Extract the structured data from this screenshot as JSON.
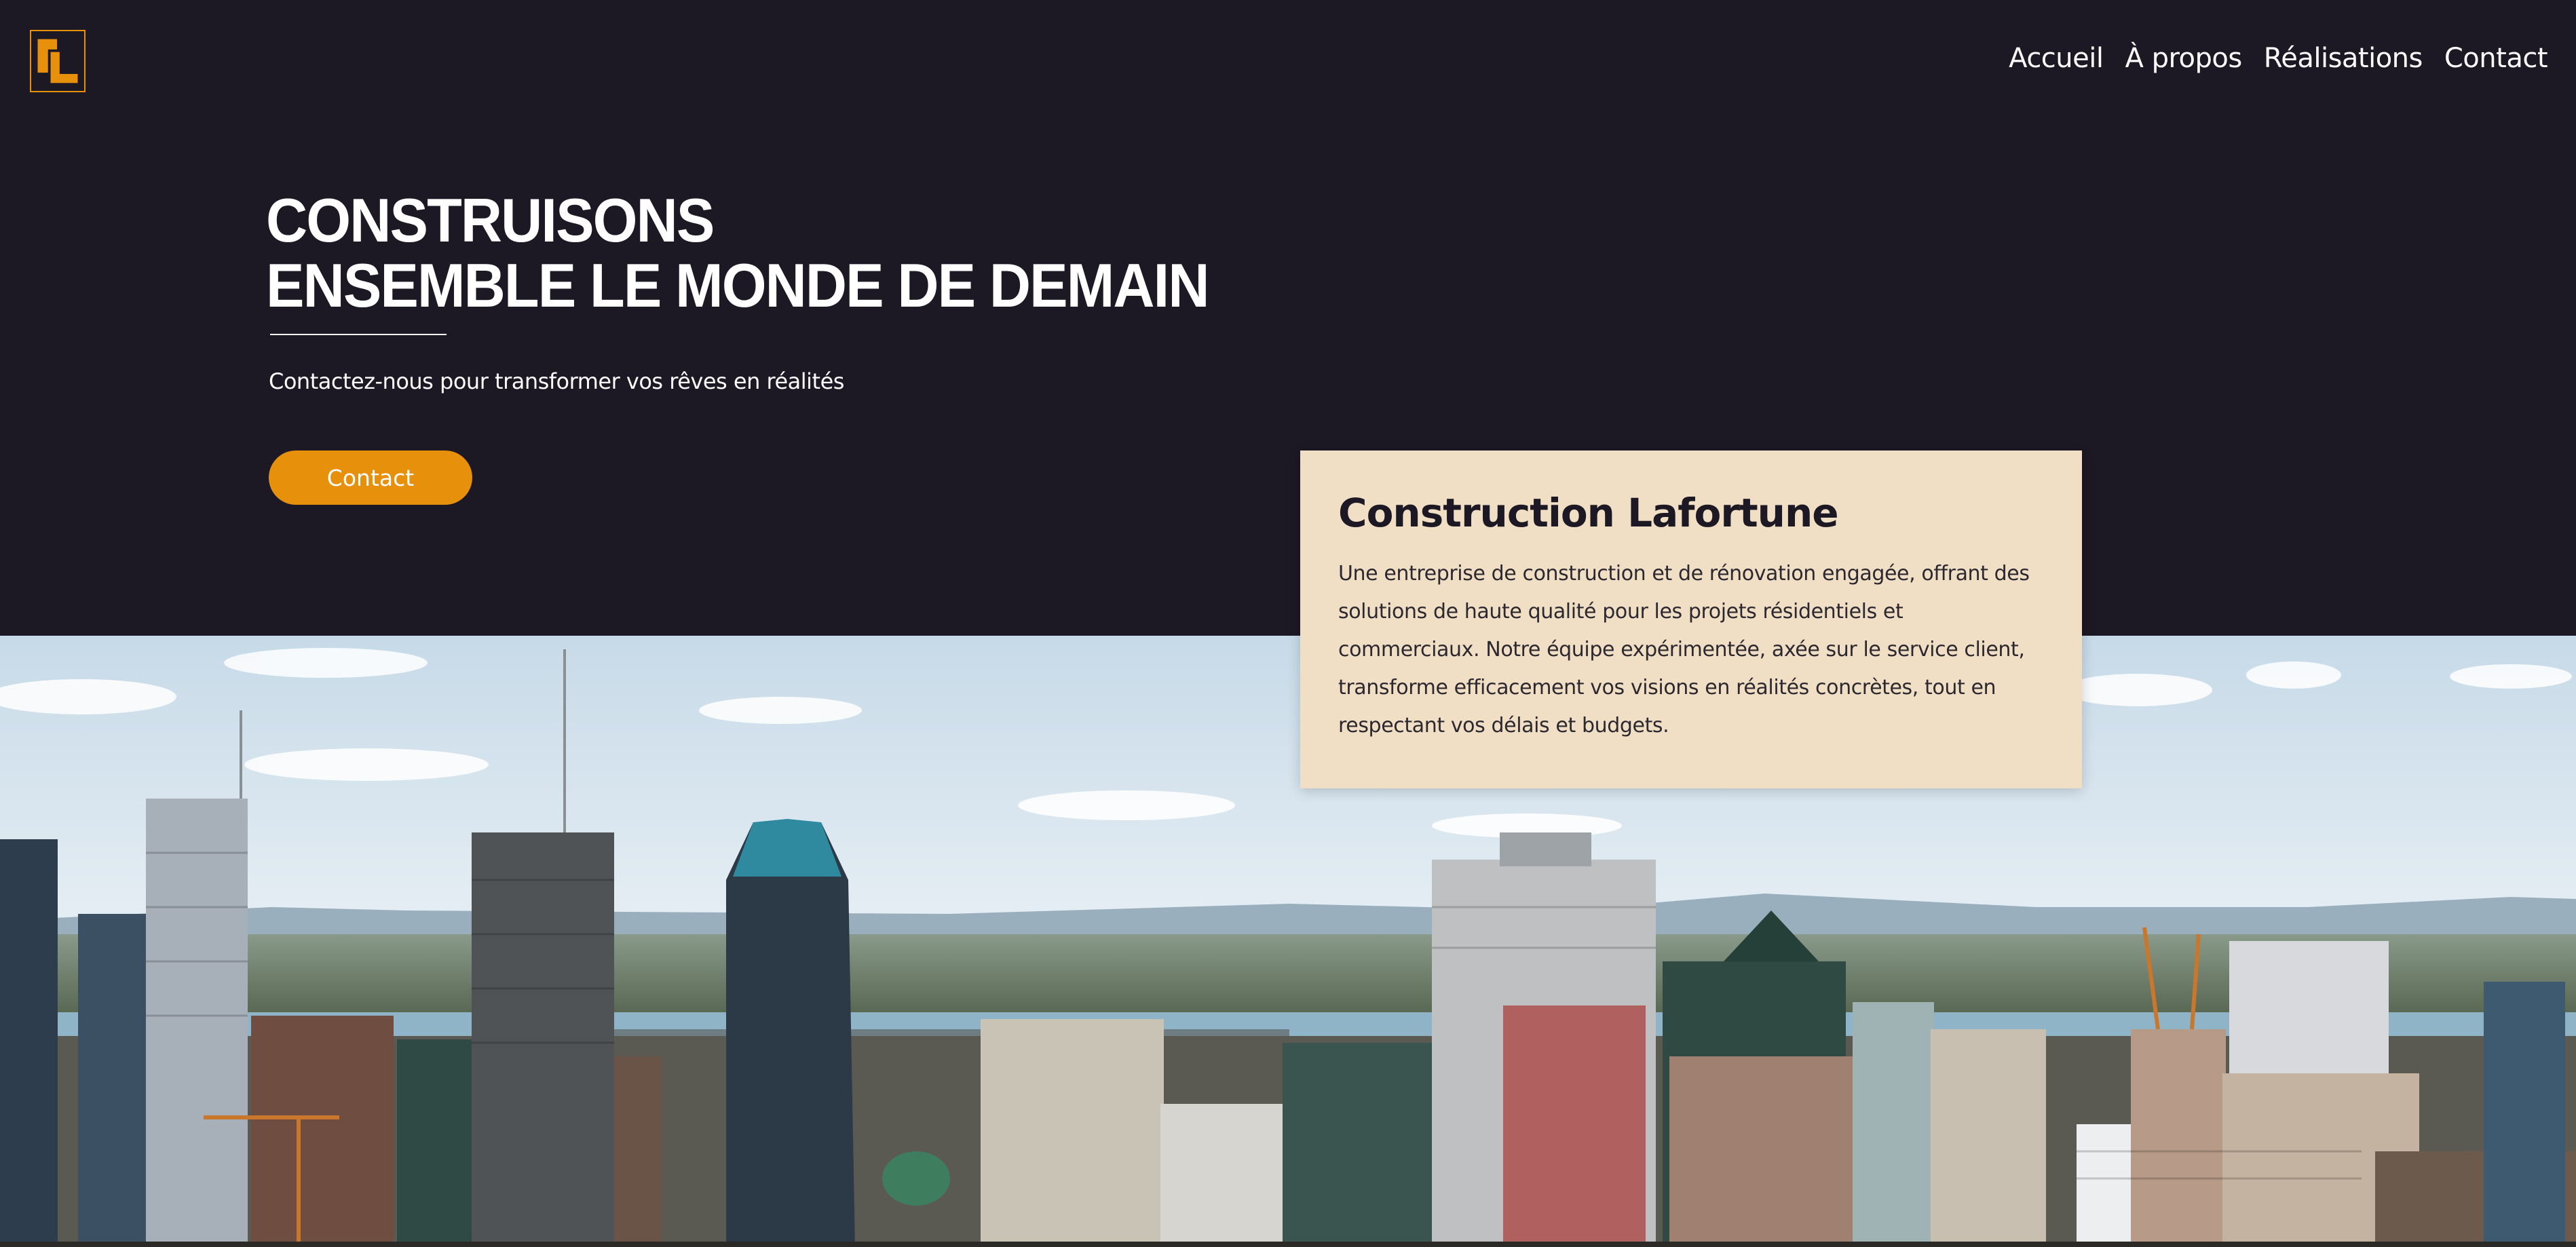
{
  "nav": {
    "items": [
      "Accueil",
      "À propos",
      "Réalisations",
      "Contact"
    ]
  },
  "hero": {
    "title_line1": "CONSTRUISONS",
    "title_line2": "ENSEMBLE LE MONDE DE DEMAIN",
    "subtitle": "Contactez-nous pour transformer vos rêves en réalités",
    "button_label": "Contact"
  },
  "card": {
    "title": "Construction Lafortune",
    "body": "Une entreprise de construction et de rénovation engagée, offrant des solutions de haute qualité pour les projets résidentiels et commerciaux. Notre équipe expérimentée, axée sur le service client, transforme efficacement vos visions en réalités concrètes, tout en respectant vos délais et budgets."
  },
  "colors": {
    "background": "#1c1824",
    "accent": "#e6900c",
    "card": "#f0dfc4",
    "text_light": "#ffffff"
  },
  "icons": {
    "logo": "cl-monogram-logo"
  }
}
